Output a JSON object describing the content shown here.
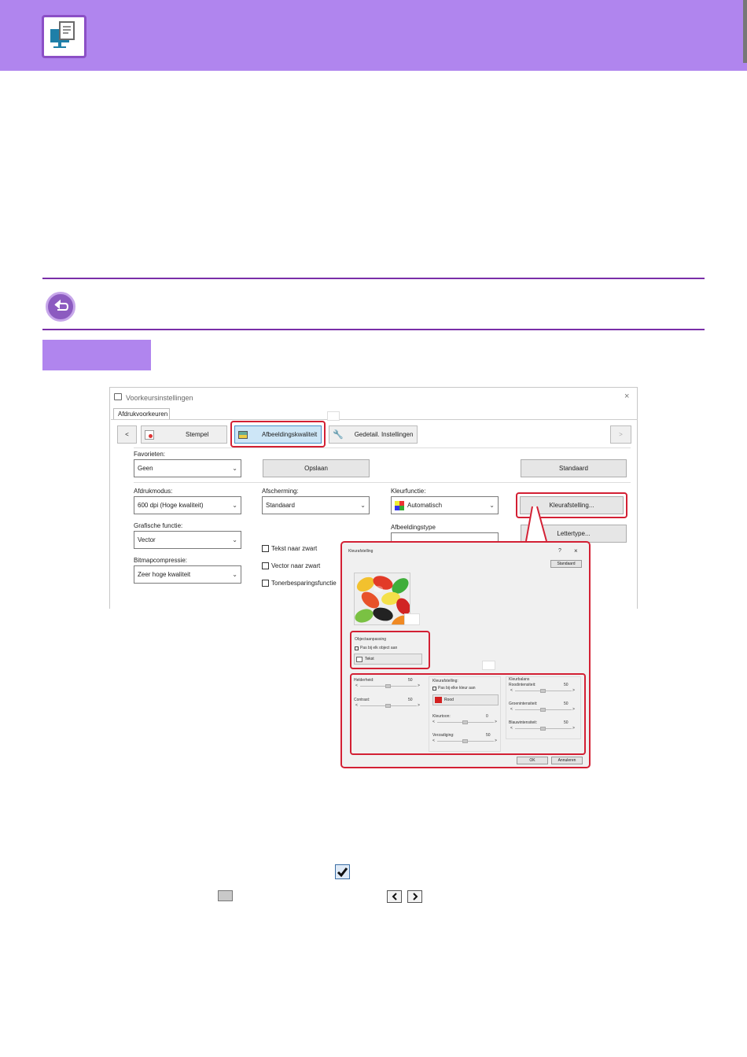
{
  "dialog1": {
    "title": "Voorkeursinstellingen",
    "close": "×",
    "tab": "Afdrukvoorkeuren",
    "nav_prev": "<",
    "nav_next": ">",
    "tabs": [
      "Stempel",
      "Afbeeldingskwaliteit",
      "Gedetail. Instellingen"
    ],
    "favorites_label": "Favorieten:",
    "favorites_value": "Geen",
    "save_button": "Opslaan",
    "default_button": "Standaard",
    "print_mode_label": "Afdrukmodus:",
    "print_mode_value": "600 dpi (Hoge kwaliteit)",
    "graphics_label": "Grafische functie:",
    "graphics_value": "Vector",
    "bitmap_label": "Bitmapcompressie:",
    "bitmap_value": "Zeer hoge kwaliteit",
    "screen_label": "Afscherming:",
    "screen_value": "Standaard",
    "checkboxes": [
      "Tekst naar zwart",
      "Vector naar zwart",
      "Tonerbesparingsfunctie"
    ],
    "color_mode_label": "Kleurfunctie:",
    "color_mode_value": "Automatisch",
    "color_adjust_button": "Kleurafstelling...",
    "image_type_label": "Afbeeldingstype",
    "font_button": "Lettertype..."
  },
  "dialog2": {
    "title": "Kleurafstelling",
    "help": "?",
    "close": "×",
    "default_button": "Standaard",
    "object_section": "Objectaanpassing",
    "object_checkbox": "Pas bij elk object aan",
    "object_value": "Tekst",
    "brightness_label": "Helderheid:",
    "brightness_value": "50",
    "contrast_label": "Contrast:",
    "contrast_value": "50",
    "color_section": "Kleurafstelling:",
    "color_checkbox": "Pas bij elke kleur aan",
    "color_value": "Rood",
    "hue_label": "Kleurtoon:",
    "hue_value": "0",
    "saturation_label": "Verzadiging:",
    "saturation_value": "50",
    "balance_section": "Kleurbalans",
    "red_label": "Roodintensiteit:",
    "red_value": "50",
    "green_label": "Groenintensiteit:",
    "green_value": "50",
    "blue_label": "Blauwintensiteit:",
    "blue_value": "50",
    "ok_button": "OK",
    "cancel_button": "Annuleren",
    "arrow_left": "<",
    "arrow_right": ">"
  },
  "icons": {
    "header_logo": "printer-computer-icon",
    "back": "return-arrow-icon",
    "checkmark": "checkbox-checked-icon",
    "slider_thumb": "slider-thumb-icon",
    "left_arrow": "arrow-left-button-icon",
    "right_arrow": "arrow-right-button-icon"
  },
  "colors": {
    "header": "#b085ee",
    "accent_line": "#7a2fa8",
    "highlight": "#d32034"
  }
}
